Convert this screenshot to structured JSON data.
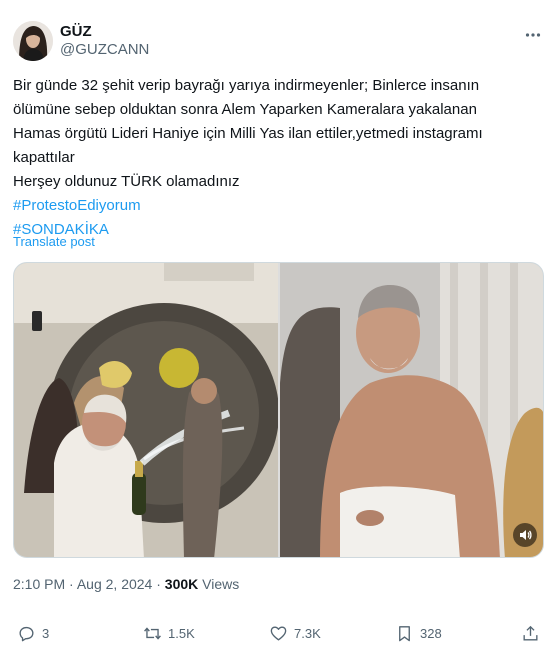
{
  "author": {
    "display_name": "GÜZ",
    "handle": "@GUZCANN"
  },
  "tweet": {
    "lines": [
      "Bir günde 32 şehit verip bayrağı yarıya indirmeyenler; Binlerce insanın",
      "ölümüne sebep olduktan sonra Alem Yaparken Kameralara yakalanan",
      "Hamas örgütü Lideri Haniye için Milli Yas ilan ettiler,yetmedi instagramı",
      "kapattılar",
      "Herşey oldunuz TÜRK olamadınız"
    ],
    "hashtags": [
      "#ProtestoEdiyorum",
      "#SONDAKİKA"
    ],
    "translate_label": "Translate post"
  },
  "meta": {
    "time": "2:10 PM",
    "separator": "·",
    "date": "Aug 2, 2024",
    "views_count": "300K",
    "views_label": "Views"
  },
  "actions": {
    "replies": "3",
    "reposts": "1.5K",
    "likes": "7.3K",
    "bookmarks": "328"
  },
  "icons": {
    "more": "more-horizontal-icon",
    "reply": "reply-icon",
    "repost": "repost-icon",
    "like": "heart-icon",
    "bookmark": "bookmark-icon",
    "share": "share-icon",
    "audio": "speaker-icon"
  },
  "colors": {
    "accent": "#1d9bf0",
    "text": "#0f1419",
    "secondary": "#536471"
  }
}
